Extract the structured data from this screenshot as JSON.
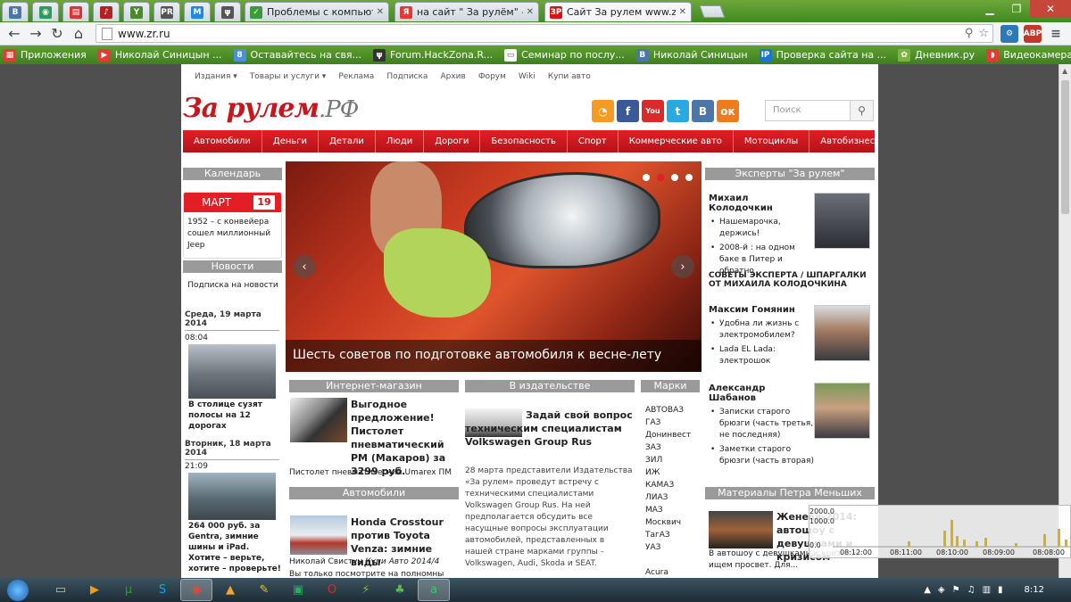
{
  "browser": {
    "tabs": [
      {
        "icon": "vk-icon",
        "title": "",
        "color": "#4a76a8",
        "glyph": "В"
      },
      {
        "icon": "chrome-app-icon",
        "title": "",
        "color": "#2a9d5c",
        "glyph": "◉"
      },
      {
        "icon": "market-icon",
        "title": "",
        "color": "#d33",
        "glyph": "▤"
      },
      {
        "icon": "music-icon",
        "title": "",
        "color": "#b52020",
        "glyph": "♪"
      },
      {
        "icon": "bird-icon",
        "title": "",
        "color": "#4a8a2a",
        "glyph": "Y"
      },
      {
        "icon": "pr-icon",
        "title": "",
        "color": "#555",
        "glyph": "PR"
      },
      {
        "icon": "mail-icon",
        "title": "",
        "color": "#1e88e5",
        "glyph": "M"
      },
      {
        "icon": "forum-icon",
        "title": "",
        "color": "#555",
        "glyph": "ψ"
      },
      {
        "icon": "forum-icon",
        "title": "Проблемы с компьютер",
        "color": "#3b9a3b",
        "glyph": "✓"
      },
      {
        "icon": "yandex-icon",
        "title": "на сайт \" За рулём\" — Ян",
        "color": "#e53935",
        "glyph": "Я"
      },
      {
        "icon": "zr-icon",
        "title": "Сайт За рулем www.zr.ru",
        "color": "#d11",
        "glyph": "ЗР"
      }
    ],
    "url": "www.zr.ru",
    "extension_badge": "ABP"
  },
  "bookmarks": [
    {
      "label": "Приложения",
      "color": "#e53935",
      "glyph": "▦"
    },
    {
      "label": "Николай Синицын ...",
      "color": "#e53935",
      "glyph": "▶"
    },
    {
      "label": "Оставайтесь на свя...",
      "color": "#4a90e2",
      "glyph": "8"
    },
    {
      "label": "Forum.HackZona.R...",
      "color": "#333",
      "glyph": "ψ"
    },
    {
      "label": "Семинар по послу...",
      "color": "#fff",
      "glyph": "▭"
    },
    {
      "label": "Николай Синицын",
      "color": "#4a76a8",
      "glyph": "В"
    },
    {
      "label": "Проверка сайта на ...",
      "color": "#1976d2",
      "glyph": "IP"
    },
    {
      "label": "Дневник.ру",
      "color": "#7cb342",
      "glyph": "✿"
    },
    {
      "label": "Видеокамера улич...",
      "color": "#e53935",
      "glyph": "◗"
    }
  ],
  "site": {
    "topnav": [
      "Издания ▾",
      "Товары и услуги ▾",
      "Реклама",
      "Подписка",
      "Архив",
      "Форум",
      "Wiki",
      "Купи авто"
    ],
    "logo_main": "За рулем",
    "logo_rf": ".РФ",
    "search_placeholder": "Поиск",
    "menu": [
      "Автомобили",
      "Деньги",
      "Детали",
      "Люди",
      "Дороги",
      "Безопасность",
      "Спорт",
      "Коммерческие авто",
      "Мотоциклы",
      "Автобизнес"
    ],
    "left": {
      "calendar_title": "Календарь",
      "month": "МАРТ",
      "day": "19",
      "cal_text": "1952 – с конвейера сошел миллионный Jeep",
      "news_title": "Новости",
      "subscribe": "Подписка на новости",
      "date1": "Среда, 19 марта 2014",
      "time1": "08:04",
      "news1": "В столице сузят полосы на 12 дорогах",
      "date2": "Вторник, 18 марта 2014",
      "time2": "21:09",
      "news2": "264 000 руб. за Gentra, зимние шины и iPad. Хотите – верьте, хотите – проверьте!"
    },
    "slider": {
      "caption": "Шесть советов по подготовке автомобиля к весне-лету"
    },
    "shop": {
      "title": "Интернет-магазин",
      "headline": "Выгодное предложение! Пистолет пневматический РМ (Макаров) за 3299 руб.",
      "sub": "Пистолет пневматический Umarex ПМ"
    },
    "cars": {
      "title": "Автомобили",
      "headline": "Honda Crosstour против Toyota Venza: зимние виды",
      "byline": "Николай Свистун",
      "source": "Купи Авто 2014/4",
      "more": "Вы только посмотрите на полномны"
    },
    "publisher": {
      "title": "В издательстве",
      "headline": "Задай свой вопрос техническим специалистам Volkswagen Group Rus",
      "body": "28 марта представители Издательства «За рулем» проведут встречу с техническими специалистами Volkswagen Group Rus. На ней предполагается обсудить все насущные вопросы эксплуатации автомобилей, представленных в нашей стране марками группы – Volkswagen, Audi, Skoda и SEAT."
    },
    "brands": {
      "title": "Марки",
      "items": [
        "АВТОВАЗ",
        "ГАЗ",
        "Донинвест",
        "ЗАЗ",
        "ЗИЛ",
        "ИЖ",
        "КАМАЗ",
        "ЛИАЗ",
        "МАЗ",
        "Москвич",
        "ТагАЗ",
        "УАЗ",
        "",
        "Acura"
      ]
    },
    "experts": {
      "title": "Эксперты \"За рулем\"",
      "e1_name": "Михаил Колодочкин",
      "e1_items": [
        "Нашемарочка, держись!",
        "2008-й : на одном баке в Питер и обратно"
      ],
      "tips": "СОВЕТЫ ЭКСПЕРТА / ШПАРГАЛКИ ОТ МИХАИЛА КОЛОДОЧКИНА",
      "e2_name": "Максим Гомянин",
      "e2_items": [
        "Удобна ли жизнь с электромобилем?",
        "Lada EL Lada: электрошок"
      ],
      "e3_name": "Александр Шабанов",
      "e3_items": [
        "Записки старого брюзги (часть третья, не последняя)",
        "Заметки старого брюзги (часть вторая)"
      ],
      "materials_title": "Материалы Петра Меньших",
      "m_headline": "Женева-2014: автошоу с девушками и кризисом",
      "m_sub": "В автошоу с девушками и кризисом ищем просвет. Для..."
    }
  },
  "overlay_graph": {
    "ylabels": [
      "2000.0",
      "1000.0",
      "0.0"
    ],
    "xlabels": [
      "08:12:00",
      "08:11:00",
      "08:10:00",
      "08:09:00",
      "08:08:00"
    ]
  },
  "taskbar": {
    "clock": "8:12",
    "apps": [
      {
        "name": "explorer-icon",
        "glyph": "▭",
        "color": "#e8c26a"
      },
      {
        "name": "media-player-icon",
        "glyph": "▶",
        "color": "#f39c12"
      },
      {
        "name": "utorrent-icon",
        "glyph": "µ",
        "color": "#2e9b2e"
      },
      {
        "name": "skype-icon",
        "glyph": "S",
        "color": "#00aff0"
      },
      {
        "name": "chrome-icon",
        "glyph": "◉",
        "color": "#e8453c"
      },
      {
        "name": "aimp-icon",
        "glyph": "▲",
        "color": "#f0a830"
      },
      {
        "name": "paint-icon",
        "glyph": "✎",
        "color": "#f1c40f"
      },
      {
        "name": "app-icon",
        "glyph": "▣",
        "color": "#27ae60"
      },
      {
        "name": "opera-icon",
        "glyph": "O",
        "color": "#e3262b"
      },
      {
        "name": "winamp-icon",
        "glyph": "⚡",
        "color": "#7fbf3f"
      },
      {
        "name": "android-icon",
        "glyph": "♣",
        "color": "#5cb85c"
      },
      {
        "name": "app2-icon",
        "glyph": "a",
        "color": "#2ecc71"
      }
    ]
  }
}
